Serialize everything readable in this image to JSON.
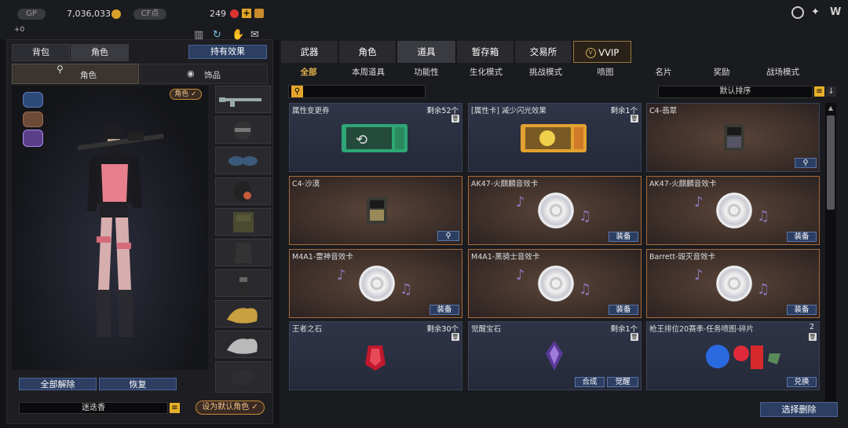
{
  "topbar": {
    "gp_label": "GP",
    "gp_value": "7,036,033",
    "cf_label": "CF点",
    "cf_value": "249",
    "sub_value": "+0"
  },
  "left": {
    "tabs": [
      "背包",
      "角色"
    ],
    "hold_button": "持有效果",
    "subtabs": [
      "角色",
      "饰品"
    ],
    "char_badge": "角色 ✓",
    "unequip_all": "全部解除",
    "restore": "恢复",
    "char_name": "迷迭香",
    "set_default": "设为默认角色 ✓"
  },
  "main_tabs": [
    "武器",
    "角色",
    "道具",
    "暂存箱",
    "交易所",
    "VVIP"
  ],
  "sub_tabs": [
    "全部",
    "本周道具",
    "功能性",
    "生化模式",
    "挑战模式",
    "喷图",
    "名片",
    "奖励",
    "战场模式"
  ],
  "sort_label": "默认排序",
  "items": [
    {
      "name": "属性变更券",
      "qty": "剩余52个",
      "art": "ticket-green"
    },
    {
      "name": "[属性卡] 减少闪光效果",
      "qty": "剩余1个",
      "art": "ticket-gold"
    },
    {
      "name": "C4-翡翠",
      "qty": "",
      "art": "c4",
      "button": "search"
    },
    {
      "name": "C4-沙漠",
      "qty": "",
      "art": "c4",
      "button": "search"
    },
    {
      "name": "AK47-火麒麟音效卡",
      "qty": "",
      "art": "disc",
      "button": "装备"
    },
    {
      "name": "AK47-火麒麟音效卡",
      "qty": "",
      "art": "disc",
      "button": "装备"
    },
    {
      "name": "M4A1-雷神音效卡",
      "qty": "",
      "art": "disc",
      "button": "装备"
    },
    {
      "name": "M4A1-黑骑士音效卡",
      "qty": "",
      "art": "disc",
      "button": "装备"
    },
    {
      "name": "Barrett-毁灭音效卡",
      "qty": "",
      "art": "disc",
      "button": "装备"
    },
    {
      "name": "王者之石",
      "qty": "剩余30个",
      "art": "gem-red"
    },
    {
      "name": "觉醒宝石",
      "qty": "剩余1个",
      "art": "gem-purple",
      "buttons": [
        "合成",
        "觉醒"
      ]
    },
    {
      "name": "枪王排位20赛季-任务喷图-碎片",
      "qty": "2",
      "art": "spray",
      "button": "兑换"
    }
  ],
  "select_delete": "选择删除"
}
